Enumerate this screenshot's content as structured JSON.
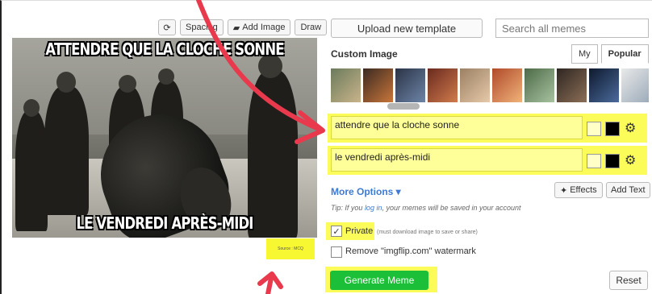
{
  "toolbar": {
    "rotate_icon": "rotate-icon",
    "spacing_label": "Spacing",
    "add_image_label": "Add Image",
    "draw_label": "Draw"
  },
  "meme": {
    "top_caption": "ATTENDRE QUE LA CLOCHE SONNE",
    "bottom_caption": "LE VENDREDI APRÈS-MIDI",
    "source_label": "Source : MCQ"
  },
  "header": {
    "upload_label": "Upload new template",
    "search_placeholder": "Search all memes"
  },
  "templates": {
    "section_title": "Custom Image",
    "tab_my": "My",
    "tab_popular": "Popular"
  },
  "text_boxes": [
    {
      "value": "attendre que la cloche sonne"
    },
    {
      "value": "le vendredi après-midi"
    }
  ],
  "options": {
    "more_options_label": "More Options ▾",
    "effects_label": "Effects",
    "add_text_label": "Add Text",
    "tip_prefix": "Tip: If you ",
    "tip_link": "log in",
    "tip_suffix": ", your memes will be saved in your account",
    "private_label": "Private",
    "private_note": "(must download image to save or share)",
    "private_checked": true,
    "watermark_label": "Remove \"imgflip.com\" watermark",
    "watermark_checked": false
  },
  "actions": {
    "generate_label": "Generate Meme",
    "reset_label": "Reset"
  },
  "colors": {
    "highlight": "#fbfb5a",
    "generate_green": "#1cbf38",
    "link_blue": "#3a7bd5",
    "annotation_red": "#e8394d"
  }
}
